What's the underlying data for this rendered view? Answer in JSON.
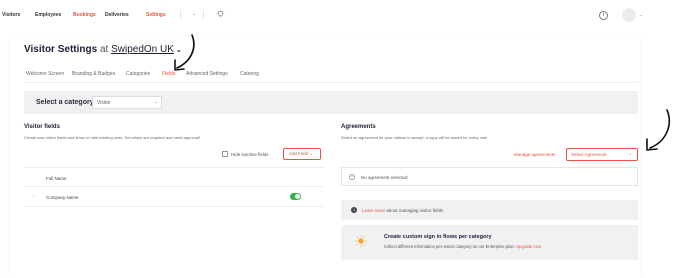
{
  "nav": {
    "items": [
      "Visitors",
      "Employees",
      "Bookings",
      "Deliveries",
      "Settings"
    ],
    "active": "Settings",
    "icons": {
      "bulb": "lightbulb-icon",
      "info": "info-icon",
      "avatar": "user-avatar"
    }
  },
  "header": {
    "title_prefix": "Visitor Settings",
    "title_at": "at",
    "title_location": "SwipedOn UK"
  },
  "tabs": [
    "Welcome Screen",
    "Branding & Badges",
    "Categories",
    "Fields",
    "Advanced Settings",
    "Catering"
  ],
  "active_tab": "Fields",
  "category": {
    "label": "Select a category",
    "value": "Visitor"
  },
  "visitor_fields": {
    "heading": "Visitor fields",
    "description": "Create new visitor fields and show or hide existing ones. Set which are required and need approval!",
    "hide_inactive_label": "Hide inactive fields",
    "add_field_label": "Add Field",
    "fields": [
      {
        "name": "Full Name"
      },
      {
        "name": "Company Name",
        "enabled": true
      }
    ]
  },
  "agreements": {
    "heading": "Agreements",
    "description": "Select an agreement for your visitors to accept, a copy will be stored for every visit.",
    "manage_label": "Manage agreements",
    "select_placeholder": "Select Agreement",
    "none_selected": "No agreement selected"
  },
  "info_bar": {
    "link": "Learn more",
    "text": "about managing visitor fields"
  },
  "promo": {
    "title": "Create custom sign in flows per category",
    "description": "Collect different information per visitor category on our Enterprise plan.",
    "link": "Upgrade now"
  },
  "colors": {
    "accent": "#e8533f",
    "toggle_on": "#2fb34b",
    "panel": "#f1f1f4",
    "title": "#1e1e35"
  }
}
